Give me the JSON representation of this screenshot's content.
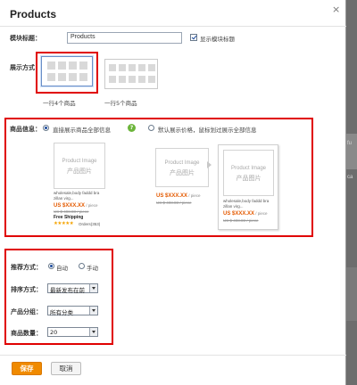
{
  "dialog": {
    "title": "Products",
    "close_glyph": "×"
  },
  "module_title": {
    "label": "模块标题：",
    "value": "Products",
    "show_title_label": "显示模块标题",
    "show_title_checked": true
  },
  "display_mode": {
    "label": "展示方式：",
    "options": [
      {
        "label": "一行4个商品",
        "columns": 4,
        "selected": true
      },
      {
        "label": "一行5个商品",
        "columns": 5,
        "selected": false
      }
    ]
  },
  "product_info": {
    "label": "商品信息：",
    "option_all": "直接展示商品全部信息",
    "option_price": "默认展示价格，鼠标划过展示全部信息",
    "selected": "all",
    "help_glyph": "?",
    "card": {
      "image_en": "Product Image",
      "image_zh": "产品图片",
      "desc": "wholesale,body faddd bra zillan virg...",
      "price": "US $XXX.XX",
      "unit": " / piece",
      "old_price": "US $ 498.88 / piece",
      "shipping": "Free Shipping",
      "stars": "★★★★★",
      "orders": "Orders(353)"
    }
  },
  "recommend": {
    "label": "推荐方式：",
    "option_auto": "自动",
    "option_manual": "手动",
    "selected": "auto"
  },
  "sort": {
    "label": "排序方式：",
    "value": "最新发布在前"
  },
  "group": {
    "label": "产品分组：",
    "value": "所有分类"
  },
  "quantity": {
    "label": "商品数量：",
    "value": "20"
  },
  "footer": {
    "save": "保存",
    "cancel": "取消"
  },
  "background": {
    "fragment_1": "fu",
    "fragment_2": "ca"
  },
  "colors": {
    "accent": "#f08a00",
    "highlight": "#e00000",
    "price": "#e45a00"
  }
}
